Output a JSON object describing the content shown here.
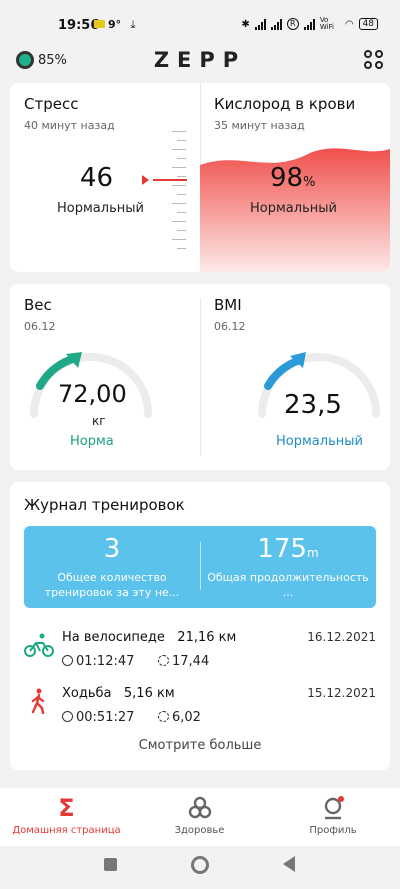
{
  "status_bar": {
    "time": "19:56",
    "temperature": "9°",
    "battery": "48",
    "vowifi": "Vo WiFi"
  },
  "header": {
    "device_battery": "85%",
    "logo": "ZEPP"
  },
  "stress": {
    "title": "Стресс",
    "time_ago": "40 минут назад",
    "value": "46",
    "status": "Нормальный"
  },
  "oxygen": {
    "title": "Кислород в крови",
    "time_ago": "35 минут назад",
    "value": "98",
    "unit": "%",
    "status": "Нормальный"
  },
  "weight": {
    "title": "Вес",
    "date": "06.12",
    "value": "72,00",
    "unit": "кг",
    "status": "Норма",
    "status_color": "#1e9e80"
  },
  "bmi": {
    "title": "BMI",
    "date": "06.12",
    "value": "23,5",
    "status": "Нормальный",
    "status_color": "#1f8fc4"
  },
  "workouts": {
    "title": "Журнал тренировок",
    "count": "3",
    "count_label": "Общее количество тренировок за эту не...",
    "duration": "175",
    "duration_unit": "m",
    "duration_label": "Общая продолжительность ...",
    "items": [
      {
        "icon": "cycling-icon",
        "name": "На велосипеде",
        "distance": "21,16 км",
        "date": "16.12.2021",
        "time": "01:12:47",
        "pace": "17,44"
      },
      {
        "icon": "walking-icon",
        "name": "Ходьба",
        "distance": "5,16 км",
        "date": "15.12.2021",
        "time": "00:51:27",
        "pace": "6,02"
      }
    ],
    "more": "Смотрите больше"
  },
  "tabs": [
    {
      "label": "Домашняя страница",
      "icon": "home-sigma-icon",
      "active": true
    },
    {
      "label": "Здоровье",
      "icon": "health-icon",
      "active": false
    },
    {
      "label": "Профиль",
      "icon": "profile-icon",
      "active": false
    }
  ],
  "colors": {
    "accent": "#e53935",
    "oxygen_fill": "#f05a57",
    "banner": "#5bc2ec"
  }
}
